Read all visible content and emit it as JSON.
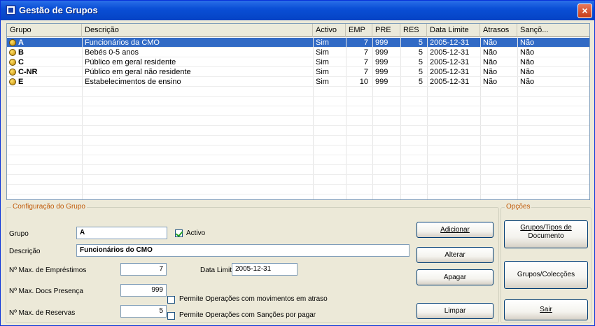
{
  "window": {
    "title": "Gestão de Grupos",
    "close_glyph": "×"
  },
  "table": {
    "columns": [
      "Grupo",
      "Descrição",
      "Activo",
      "EMP",
      "PRE",
      "RES",
      "Data Limite",
      "Atrasos",
      "Sançõ..."
    ],
    "rows": [
      {
        "grupo": "A",
        "descricao": "Funcionários da CMO",
        "activo": "Sim",
        "emp": "7",
        "pre": "999",
        "res": "5",
        "data": "2005-12-31",
        "atrasos": "Não",
        "sancoes": "Não",
        "selected": true
      },
      {
        "grupo": "B",
        "descricao": "Bebés 0-5 anos",
        "activo": "Sim",
        "emp": "7",
        "pre": "999",
        "res": "5",
        "data": "2005-12-31",
        "atrasos": "Não",
        "sancoes": "Não",
        "selected": false
      },
      {
        "grupo": "C",
        "descricao": "Público em geral residente",
        "activo": "Sim",
        "emp": "7",
        "pre": "999",
        "res": "5",
        "data": "2005-12-31",
        "atrasos": "Não",
        "sancoes": "Não",
        "selected": false
      },
      {
        "grupo": "C-NR",
        "descricao": "Público em geral não residente",
        "activo": "Sim",
        "emp": "7",
        "pre": "999",
        "res": "5",
        "data": "2005-12-31",
        "atrasos": "Não",
        "sancoes": "Não",
        "selected": false
      },
      {
        "grupo": "E",
        "descricao": "Estabelecimentos de ensino",
        "activo": "Sim",
        "emp": "10",
        "pre": "999",
        "res": "5",
        "data": "2005-12-31",
        "atrasos": "Não",
        "sancoes": "Não",
        "selected": false
      }
    ]
  },
  "config": {
    "legend": "Configuração do Grupo",
    "grupo_label": "Grupo",
    "grupo_value": "A",
    "activo_label": "Activo",
    "activo_checked": true,
    "descricao_label": "Descrição",
    "descricao_value": "Funcionários do CMO",
    "max_emp_label": "Nº Max. de Empréstimos",
    "max_emp_value": "7",
    "data_limite_label": "Data Limite",
    "data_limite_value": "2005-12-31",
    "max_pres_label": "Nº Max. Docs Presença",
    "max_pres_value": "999",
    "max_res_label": "Nº Max. de Reservas",
    "max_res_value": "5",
    "perm_atraso_label": "Permite Operações com movimentos em atraso",
    "perm_sancoes_label": "Permite Operações com Sanções por pagar"
  },
  "actions": {
    "adicionar": "Adicionar",
    "alterar": "Alterar",
    "apagar": "Apagar",
    "limpar": "Limpar"
  },
  "options": {
    "legend": "Opções",
    "grupos_tipos_line1": "Grupos/Tipos de",
    "grupos_tipos_line2": "Documento",
    "grupos_coleccoes": "Grupos/Colecções",
    "sair": "Sair"
  },
  "icons": {
    "row_icon": "group-coin-icon",
    "app_icon": "app-window-icon",
    "close": "close-icon"
  }
}
